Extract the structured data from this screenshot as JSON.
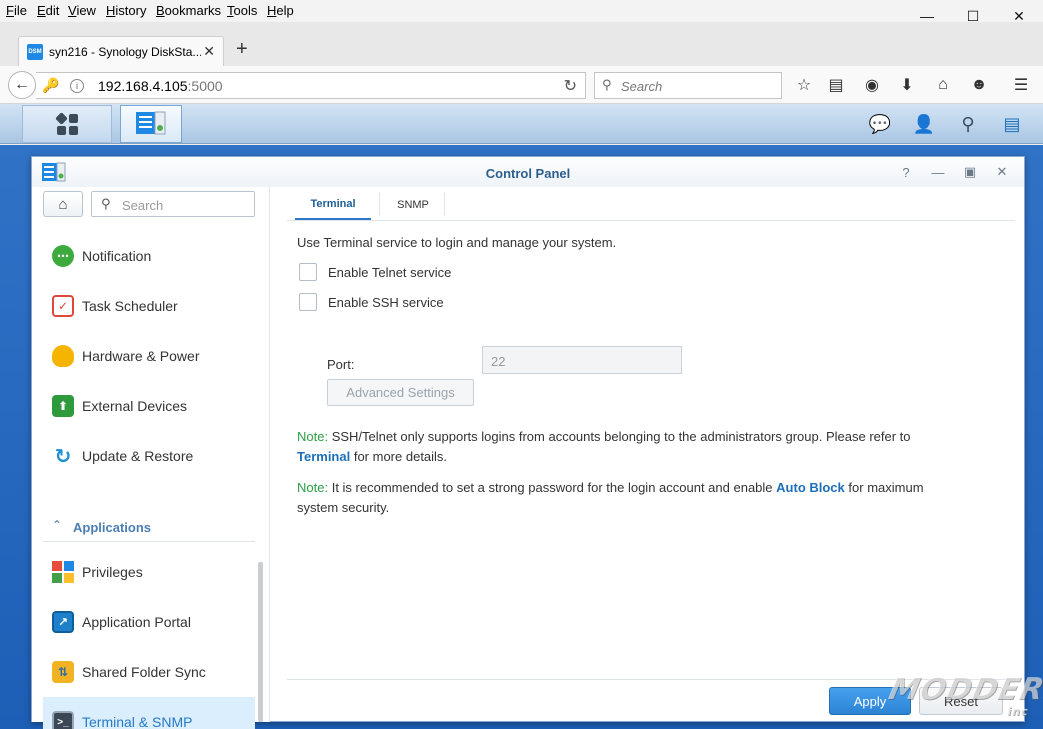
{
  "browser": {
    "menu": [
      "File",
      "Edit",
      "View",
      "History",
      "Bookmarks",
      "Tools",
      "Help"
    ],
    "tab_title": "syn216 - Synology DiskSta...",
    "favicon_text": "DSM",
    "url_host": "192.168.4.105",
    "url_port": ":5000",
    "search_placeholder": "Search",
    "window_controls": [
      "minimize-icon",
      "maximize-icon",
      "close-icon"
    ],
    "toolbar_icons": [
      "star-icon",
      "reading-list-icon",
      "pocket-icon",
      "download-icon",
      "home-icon",
      "emoji-icon",
      "hamburger-menu-icon"
    ]
  },
  "dsm_taskbar": {
    "left_icons": [
      "main-menu-icon",
      "control-panel-icon"
    ],
    "right_icons": [
      "chat-icon",
      "user-icon",
      "search-icon",
      "widgets-icon"
    ]
  },
  "control_panel": {
    "title": "Control Panel",
    "title_buttons": [
      "help-icon",
      "minimize-icon",
      "maximize-icon",
      "close-icon"
    ],
    "sidebar": {
      "search_placeholder": "Search",
      "items_top": [
        {
          "label": "Notification",
          "icon": "notification-icon",
          "color": "#3daa3d"
        },
        {
          "label": "Task Scheduler",
          "icon": "task-scheduler-icon",
          "color": "#e0473c"
        },
        {
          "label": "Hardware & Power",
          "icon": "hardware-power-icon",
          "color": "#f4b400"
        },
        {
          "label": "External Devices",
          "icon": "external-devices-icon",
          "color": "#2f9a3c"
        },
        {
          "label": "Update & Restore",
          "icon": "update-restore-icon",
          "color": "#1c8fd6"
        }
      ],
      "section_label": "Applications",
      "items_apps": [
        {
          "label": "Privileges",
          "icon": "privileges-icon",
          "color": "#e64b3c"
        },
        {
          "label": "Application Portal",
          "icon": "application-portal-icon",
          "color": "#1e7fcb"
        },
        {
          "label": "Shared Folder Sync",
          "icon": "shared-folder-sync-icon",
          "color": "#f1b323"
        },
        {
          "label": "Terminal & SNMP",
          "icon": "terminal-icon",
          "color": "#3b4754",
          "active": true
        }
      ]
    },
    "tabs": [
      "Terminal",
      "SNMP"
    ],
    "active_tab": "Terminal",
    "description": "Use Terminal service to login and manage your system.",
    "options": {
      "telnet_label": "Enable Telnet service",
      "telnet_checked": false,
      "ssh_label": "Enable SSH service",
      "ssh_checked": false
    },
    "port_label": "Port:",
    "port_value": "22",
    "advanced_button": "Advanced Settings",
    "note1": {
      "tag": "Note:",
      "text": "SSH/Telnet only supports logins from accounts belonging to the administrators group. Please refer to",
      "link": "Terminal",
      "text_after": "for more details."
    },
    "note2": {
      "tag": "Note:",
      "text": "It is recommended to set a strong password for the login account and enable",
      "link": "Auto Block",
      "text_after": "for maximum",
      "text_line2": "system security."
    },
    "apply_label": "Apply",
    "reset_label": "Reset"
  },
  "watermark": {
    "text": "MODDERS",
    "sub": "inc"
  }
}
